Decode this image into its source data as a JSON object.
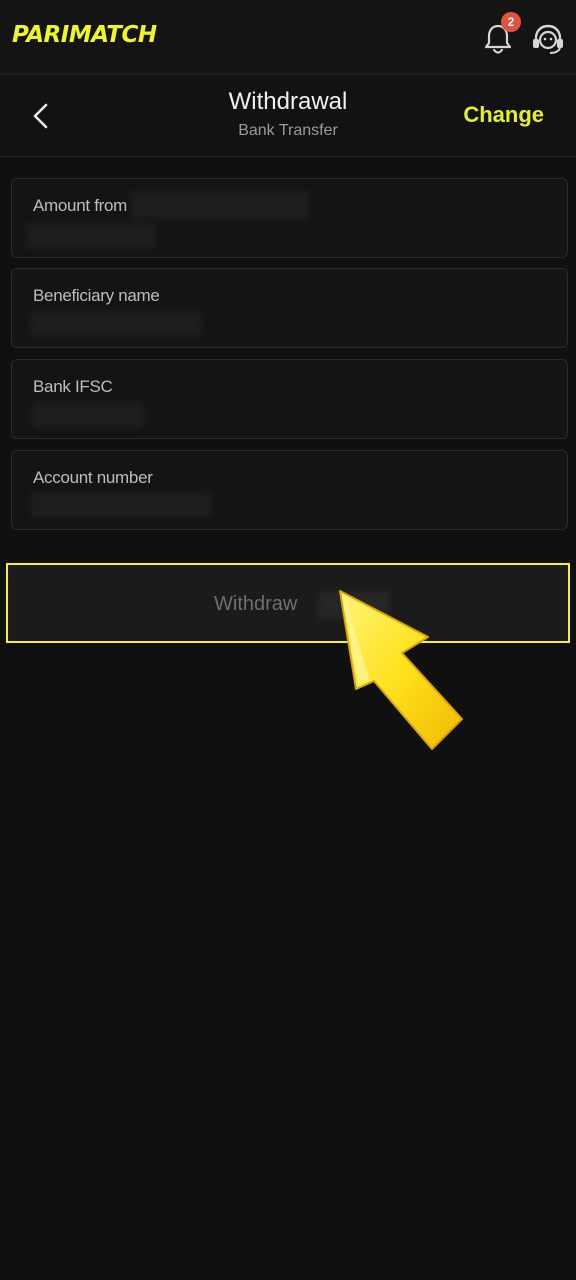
{
  "topbar": {
    "logo_text": "PARIMATCH",
    "notification_count": "2"
  },
  "header": {
    "title": "Withdrawal",
    "subtitle": "Bank Transfer",
    "change_label": "Change"
  },
  "form": {
    "fields": [
      {
        "label": "Amount from"
      },
      {
        "label": "Beneficiary name"
      },
      {
        "label": "Bank IFSC"
      },
      {
        "label": "Account number"
      }
    ],
    "withdraw_label": "Withdraw"
  },
  "colors": {
    "brand_yellow": "#f0f524",
    "badge_red": "#e2533f",
    "highlight_border": "#f3ef3a"
  }
}
